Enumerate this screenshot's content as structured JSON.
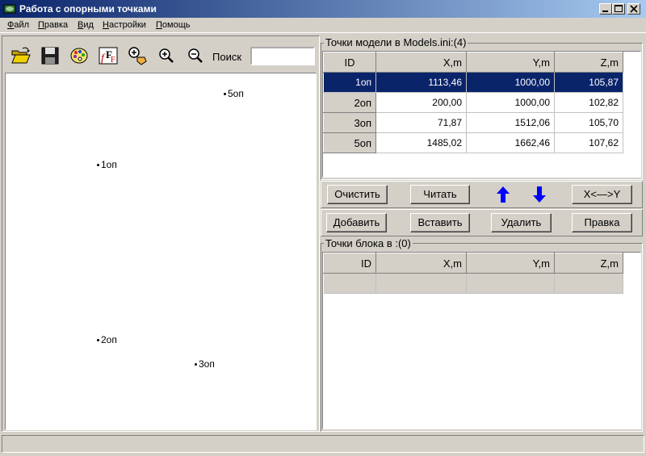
{
  "window": {
    "title": "Работа с опорными точками"
  },
  "menu": [
    {
      "first": "Ф",
      "rest": "айл"
    },
    {
      "first": "П",
      "rest": "равка"
    },
    {
      "first": "В",
      "rest": "ид"
    },
    {
      "first": "Н",
      "rest": "астройки"
    },
    {
      "first": "П",
      "rest": "омощь"
    }
  ],
  "toolbar": {
    "search_label": "Поиск",
    "search_value": ""
  },
  "canvas_points": [
    "5оп",
    "1оп",
    "2оп",
    "3оп"
  ],
  "model_points": {
    "title": "Точки модели в Models.ini:(4)",
    "columns": [
      "ID",
      "X,m",
      "Y,m",
      "Z,m"
    ],
    "rows": [
      [
        "1оп",
        "1113,46",
        "1000,00",
        "105,87"
      ],
      [
        "2оп",
        "200,00",
        "1000,00",
        "102,82"
      ],
      [
        "3оп",
        "71,87",
        "1512,06",
        "105,70"
      ],
      [
        "5оп",
        "1485,02",
        "1662,46",
        "107,62"
      ]
    ]
  },
  "buttons_row1": {
    "clear": "Очистить",
    "read": "Читать",
    "swap": "X<—>Y"
  },
  "buttons_row2": {
    "add": "Добавить",
    "insert": "Вставить",
    "delete": "Удалить",
    "edit": "Правка"
  },
  "block_points": {
    "title": "Точки блока в :(0)",
    "columns": [
      "ID",
      "X,m",
      "Y,m",
      "Z,m"
    ]
  },
  "colors": {
    "selection": "#0a246a",
    "arrow": "#0000ff",
    "face": "#d4d0c8"
  }
}
